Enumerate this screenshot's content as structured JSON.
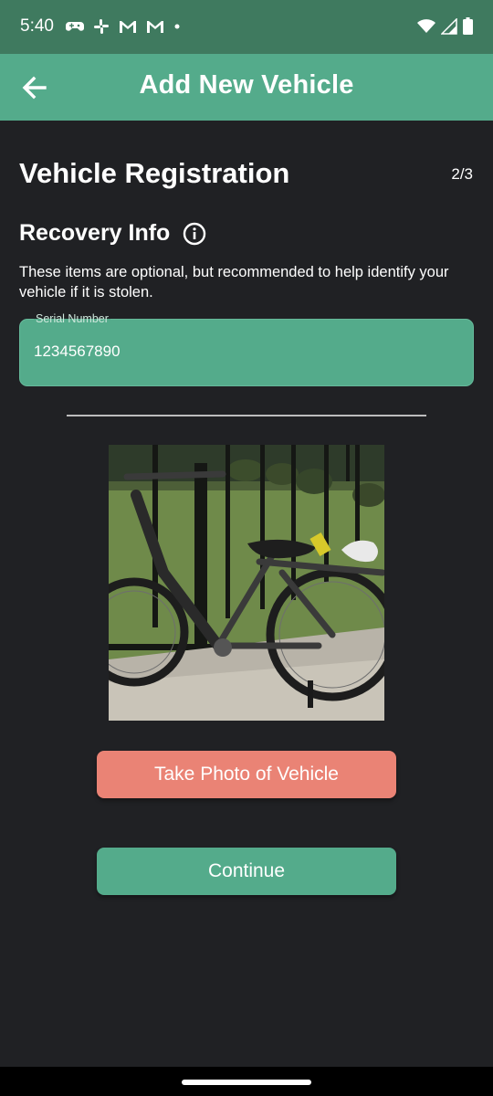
{
  "status_bar": {
    "time": "5:40",
    "left_icons": [
      "game-controller-icon",
      "slack-icon",
      "gmail-icon",
      "gmail-icon",
      "dot-icon"
    ],
    "right_icons": [
      "wifi-icon",
      "signal-icon",
      "battery-icon"
    ]
  },
  "app_bar": {
    "title": "Add New Vehicle",
    "back_icon": "arrow-back-icon"
  },
  "form": {
    "section_title": "Vehicle Registration",
    "step": "2/3",
    "subsection_title": "Recovery Info",
    "info_icon": "info-icon",
    "helper_text": "These items are optional, but recommended to help identify your vehicle if it is stolen.",
    "serial_number": {
      "label": "Serial Number",
      "value": "1234567890"
    }
  },
  "buttons": {
    "take_photo": "Take Photo of Vehicle",
    "continue": "Continue"
  },
  "colors": {
    "primary": "#54ab8b",
    "status_bar": "#3f7a5f",
    "accent": "#ea8375",
    "background": "#202124"
  }
}
